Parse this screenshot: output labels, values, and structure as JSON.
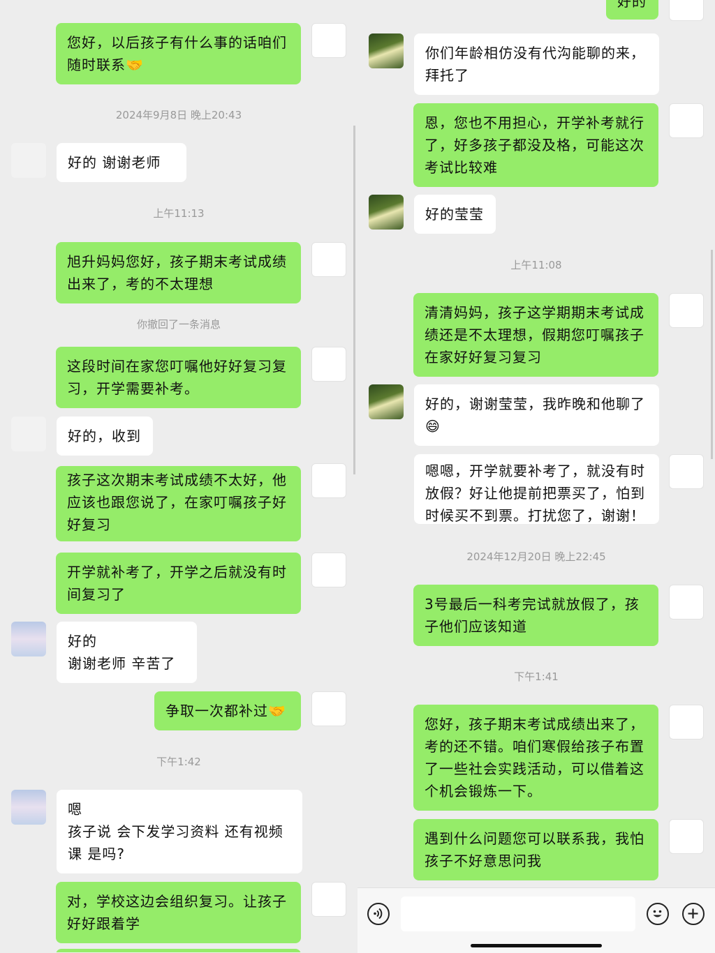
{
  "left": {
    "timestamps": [
      "2024年9月8日 晚上20:43",
      "上午11:13",
      "你撤回了一条消息",
      "下午1:42"
    ],
    "messages": [
      "您好，以后孩子有什么事的话咱们随时联系🤝",
      "好的  谢谢老师",
      "旭升妈妈您好，孩子期末考试成绩出来了，考的不太理想",
      "这段时间在家您叮嘱他好好复习复习，开学需要补考。",
      "好的，收到",
      "孩子这次期末考试成绩不太好，他应该也跟您说了，在家叮嘱孩子好好复习",
      "开学就补考了，开学之后就没有时间复习了",
      "好的\n谢谢老师  辛苦了",
      "争取一次都补过🤝",
      "嗯\n孩子说  会下发学习资料  还有视频课  是吗?",
      "对，学校这边会组织复习。让孩子好好跟着学"
    ]
  },
  "right": {
    "timestamps": [
      "上午11:08",
      "2024年12月20日 晚上22:45",
      "下午1:41"
    ],
    "messages": [
      "好的",
      "你们年龄相仿没有代沟能聊的来，拜托了",
      "恩，您也不用担心，开学补考就行了，好多孩子都没及格，可能这次考试比较难",
      "好的莹莹",
      "清清妈妈，孩子这学期期末考试成绩还是不太理想，假期您叮嘱孩子在家好好复习复习",
      "好的，谢谢莹莹，我昨晚和他聊了😄",
      "嗯嗯，开学就要补考了，就没有时放假？好让他提前把票买了，怕到时候买不到票。打扰您了，谢谢！",
      "3号最后一科考完试就放假了，孩子他们应该知道",
      "您好，孩子期末考试成绩出来了，考的还不错。咱们寒假给孩子布置了一些社会实践活动，可以借着这个机会锻炼一下。",
      "遇到什么问题您可以联系我，我怕孩子不好意思问我"
    ]
  },
  "input_bar": {
    "voice_icon": "voice-icon",
    "emoji_icon": "emoji-icon",
    "plus_icon": "plus-icon"
  },
  "colors": {
    "sent_bubble": "#95ec69",
    "received_bubble": "#ffffff",
    "background": "#ededed"
  }
}
